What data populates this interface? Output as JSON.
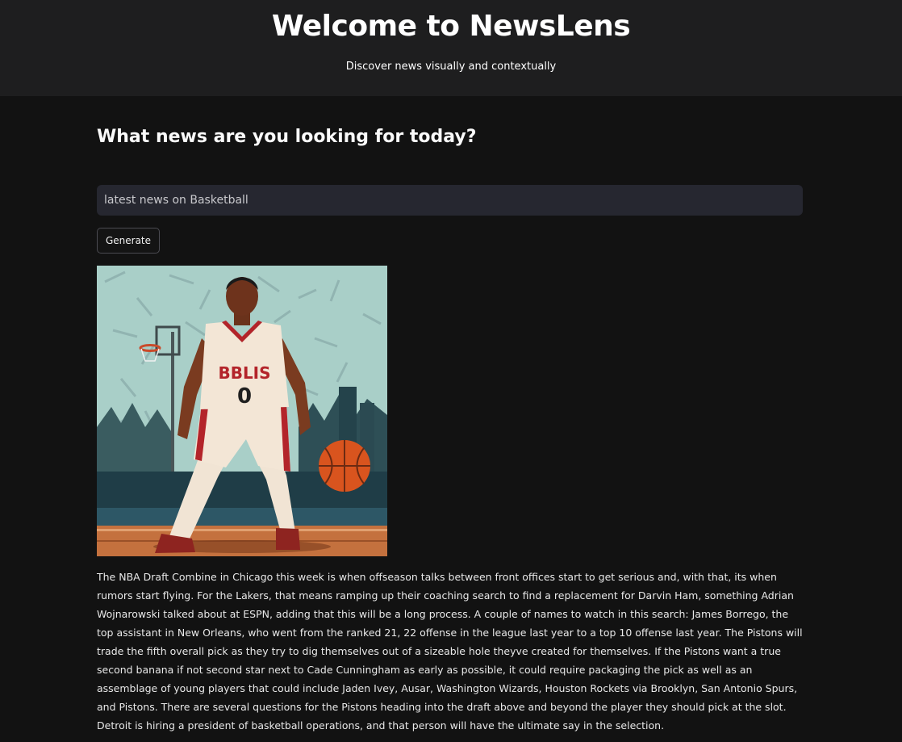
{
  "header": {
    "title": "Welcome to NewsLens",
    "subtitle": "Discover news visually and contextually"
  },
  "main": {
    "heading": "What news are you looking for today?",
    "search": {
      "value": "latest news on Basketball"
    },
    "generate_label": "Generate",
    "image": {
      "jersey_text": "BBLIS",
      "jersey_number": "0"
    },
    "article": "The NBA Draft Combine in Chicago this week is when offseason talks between front offices start to get serious and, with that, its when rumors start flying. For the Lakers, that means ramping up their coaching search to find a replacement for Darvin Ham, something Adrian Wojnarowski talked about at ESPN, adding that this will be a long process. A couple of names to watch in this search: James Borrego, the top assistant in New Orleans, who went from the ranked 21, 22 offense in the league last year to a top 10 offense last year. The Pistons will trade the fifth overall pick as they try to dig themselves out of a sizeable hole theyve created for themselves. If the Pistons want a true second banana if not second star next to Cade Cunningham as early as possible, it could require packaging the pick as well as an assemblage of young players that could include Jaden Ivey, Ausar, Washington Wizards, Houston Rockets via Brooklyn, San Antonio Spurs, and Pistons. There are several questions for the Pistons heading into the draft above and beyond the player they should pick at the slot. Detroit is hiring a president of basketball operations, and that person will have the ultimate say in the selection."
  },
  "colors": {
    "background": "#121212",
    "header_background": "#1e1e1f",
    "input_background": "#262730",
    "jersey": "#f3e6d6",
    "jersey_trim": "#b3242a",
    "ball": "#d9541e",
    "sky": "#a9cfc8"
  }
}
